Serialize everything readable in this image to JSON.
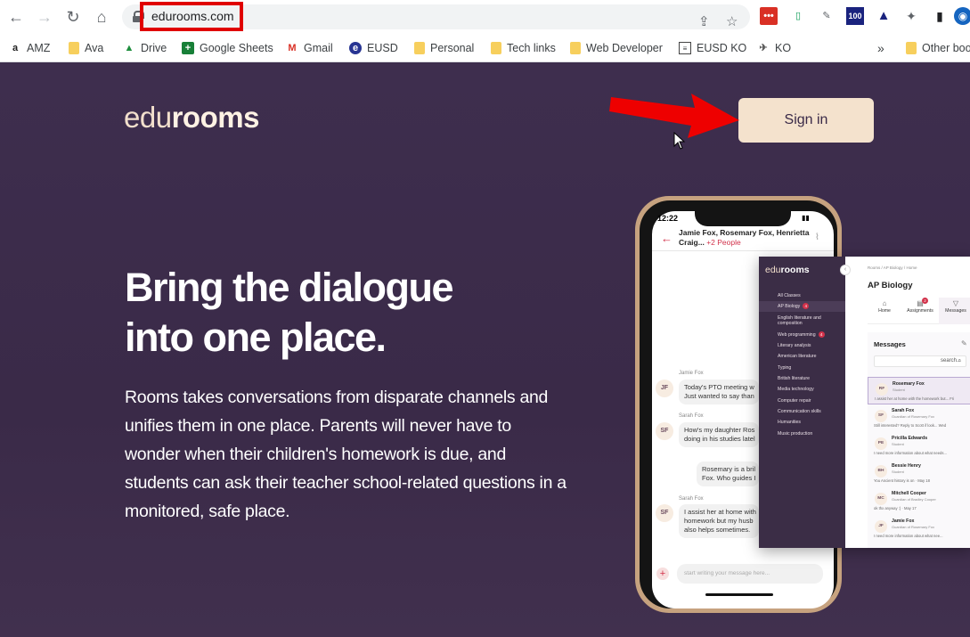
{
  "browser": {
    "url": "edurooms.com",
    "bookmarks": [
      {
        "label": "AMZ",
        "icon": "amazon-icon"
      },
      {
        "label": "Ava",
        "icon": "folder-icon"
      },
      {
        "label": "Drive",
        "icon": "drive-icon"
      },
      {
        "label": "Google Sheets",
        "icon": "sheets-icon"
      },
      {
        "label": "Gmail",
        "icon": "gmail-icon"
      },
      {
        "label": "EUSD",
        "icon": "eusd-icon"
      },
      {
        "label": "Personal",
        "icon": "folder-icon"
      },
      {
        "label": "Tech links",
        "icon": "folder-icon"
      },
      {
        "label": "Web Developer",
        "icon": "folder-icon"
      },
      {
        "label": "EUSD KO",
        "icon": "doc-icon"
      },
      {
        "label": "KO",
        "icon": "ko-icon"
      }
    ],
    "overflow": "»",
    "other_bookmarks": "Other boo",
    "extension_badge": "100"
  },
  "site": {
    "logo_light": "edu",
    "logo_bold": "rooms",
    "sign_in": "Sign in",
    "hero_title_1": "Bring the dialogue",
    "hero_title_2": "into one place.",
    "hero_body": "Rooms takes conversations from disparate channels and unifies them in one place. Parents will never have to wonder when their children's homework is due, and students can ask their teacher school-related questions in a monitored, safe place."
  },
  "phone": {
    "time": "12:22",
    "chat_title": "Jamie Fox, Rosemary Fox, Henrietta Craig...",
    "chat_more": "+2 People",
    "messages": [
      {
        "name": "Jamie Fox",
        "initials": "JF",
        "text1": "Today's PTO meeting w",
        "text2": "Just wanted to say than"
      },
      {
        "name": "Sarah Fox",
        "initials": "SF",
        "text1": "How's my daughter Ros",
        "text2": "doing in his studies latel"
      },
      {
        "name": "",
        "initials": "",
        "text1": "Rosemary is a bril",
        "text2": "Fox. Who guides I"
      },
      {
        "name": "Sarah Fox",
        "initials": "SF",
        "text1": "I assist her at home with",
        "text2": "homework but my husb",
        "text3": "also helps sometimes."
      }
    ],
    "compose_placeholder": "start writing your message here..."
  },
  "dashboard": {
    "logo_light": "edu",
    "logo_bold": "rooms",
    "nav": [
      {
        "label": "All Classes",
        "badge": ""
      },
      {
        "label": "AP Biology",
        "badge": "4"
      },
      {
        "label": "English literature and composition",
        "badge": ""
      },
      {
        "label": "Web programming",
        "badge": "4"
      },
      {
        "label": "Literary analysis",
        "badge": ""
      },
      {
        "label": "American literature",
        "badge": ""
      },
      {
        "label": "Typing",
        "badge": ""
      },
      {
        "label": "British literature",
        "badge": ""
      },
      {
        "label": "Media technology",
        "badge": ""
      },
      {
        "label": "Computer repair",
        "badge": ""
      },
      {
        "label": "Communication skills",
        "badge": ""
      },
      {
        "label": "Humanities",
        "badge": ""
      },
      {
        "label": "Music production",
        "badge": ""
      }
    ],
    "breadcrumb": "Rooms  /  AP Biology  /  Home",
    "title": "AP Biology",
    "tabs": [
      "Home",
      "Assignments",
      "Messages"
    ],
    "assignments_badge": "2",
    "messages_heading": "Messages",
    "search_placeholder": "search...",
    "threads": [
      {
        "initials": "RF",
        "name": "Rosemary Fox",
        "role": "Student",
        "preview": "I assist her at home with the homework but... Fri"
      },
      {
        "initials": "SF",
        "name": "Sarah Fox",
        "role": "Guardian of Rosemary Fox",
        "preview": "Still interested? Reply to Scott if look... Wed"
      },
      {
        "initials": "PE",
        "name": "Pricilla Edwards",
        "role": "Student",
        "preview": "I need more information about what needs..."
      },
      {
        "initials": "BH",
        "name": "Bessie Henry",
        "role": "Student",
        "preview": "You Ancient history is on · May 18"
      },
      {
        "initials": "MC",
        "name": "Mitchell Cooper",
        "role": "Guardian of Bradley Cooper",
        "preview": "ok thx anyway :) · May 17"
      },
      {
        "initials": "JF",
        "name": "Jamie Fox",
        "role": "Guardian of Rosemary Fox",
        "preview": "I need more information about what nee..."
      }
    ]
  },
  "colors": {
    "background": "#3d2d4d",
    "accent": "#f4e2cd",
    "highlight": "#e00000",
    "badge": "#d2314a"
  }
}
